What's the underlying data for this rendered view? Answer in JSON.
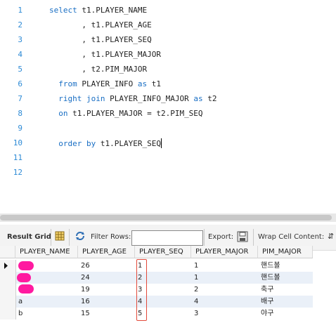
{
  "editor": {
    "lines": [
      {
        "num": "1",
        "tokens": [
          [
            "kw",
            "select"
          ],
          [
            "txt",
            " t1.PLAYER_NAME"
          ]
        ]
      },
      {
        "num": "2",
        "tokens": [
          [
            "txt",
            "       , t1.PLAYER_AGE"
          ]
        ]
      },
      {
        "num": "3",
        "tokens": [
          [
            "txt",
            "       , t1.PLAYER_SEQ"
          ]
        ]
      },
      {
        "num": "4",
        "tokens": [
          [
            "txt",
            "       , t1.PLAYER_MAJOR"
          ]
        ]
      },
      {
        "num": "5",
        "tokens": [
          [
            "txt",
            "       , t2.PIM_MAJOR"
          ]
        ]
      },
      {
        "num": "6",
        "tokens": [
          [
            "kw",
            "  from"
          ],
          [
            "txt",
            " PLAYER_INFO "
          ],
          [
            "kw",
            "as"
          ],
          [
            "txt",
            " t1"
          ]
        ]
      },
      {
        "num": "7",
        "tokens": [
          [
            "kw",
            "  right join"
          ],
          [
            "txt",
            " PLAYER_INFO_MAJOR "
          ],
          [
            "kw",
            "as"
          ],
          [
            "txt",
            " t2"
          ]
        ]
      },
      {
        "num": "8",
        "tokens": [
          [
            "kw",
            "  on"
          ],
          [
            "txt",
            " t1.PLAYER_MAJOR = t2.PIM_SEQ"
          ]
        ]
      },
      {
        "num": "9",
        "tokens": []
      },
      {
        "num": "10",
        "tokens": [
          [
            "kw",
            "  order by"
          ],
          [
            "txt",
            " t1.PLAYER_SEQ"
          ]
        ]
      },
      {
        "num": "11",
        "tokens": []
      },
      {
        "num": "12",
        "tokens": []
      }
    ]
  },
  "toolbar": {
    "result_grid_label": "Result Grid",
    "filter_rows_label": "Filter Rows:",
    "filter_rows_value": "",
    "export_label": "Export:",
    "wrap_label": "Wrap Cell Content:",
    "icons": [
      "grid-icon",
      "refresh-icon",
      "export-icon",
      "wrap-icon"
    ]
  },
  "grid": {
    "columns": [
      "PLAYER_NAME",
      "PLAYER_AGE",
      "PLAYER_SEQ",
      "PLAYER_MAJOR",
      "PIM_MAJOR"
    ],
    "rows": [
      [
        "",
        "26",
        "1",
        "1",
        "핸드볼"
      ],
      [
        "",
        "24",
        "2",
        "1",
        "핸드볼"
      ],
      [
        "",
        "19",
        "3",
        "2",
        "축구"
      ],
      [
        "a",
        "16",
        "4",
        "4",
        "배구"
      ],
      [
        "b",
        "15",
        "5",
        "3",
        "야구"
      ]
    ],
    "redaction_color": "#ff1aa0",
    "highlight_color": "#e24a3b"
  }
}
